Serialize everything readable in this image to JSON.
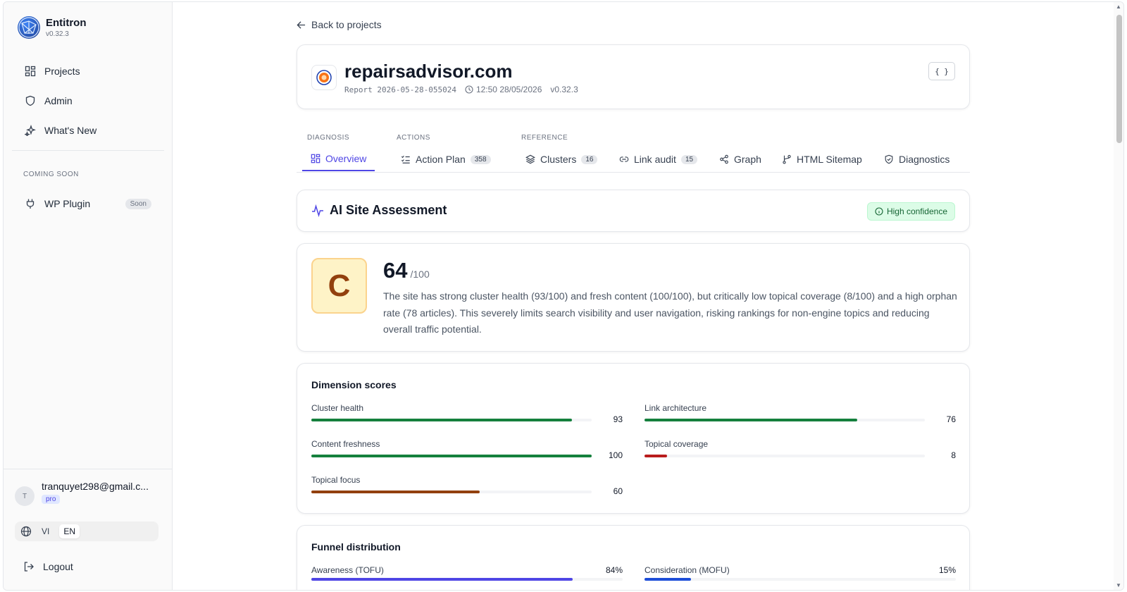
{
  "sidebar": {
    "brand": {
      "name": "Entitron",
      "version": "v0.32.3"
    },
    "nav": [
      {
        "label": "Projects",
        "icon": "grid-icon"
      },
      {
        "label": "Admin",
        "icon": "shield-icon"
      },
      {
        "label": "What's New",
        "icon": "sparkles-icon"
      }
    ],
    "coming_soon_label": "COMING SOON",
    "wp_plugin": {
      "label": "WP Plugin",
      "badge": "Soon"
    },
    "user": {
      "initial": "T",
      "email": "tranquyet298@gmail.c...",
      "plan": "pro"
    },
    "languages": [
      "VI",
      "EN"
    ],
    "active_language": "EN",
    "logout_label": "Logout"
  },
  "main": {
    "back_label": "Back to projects",
    "header": {
      "title": "repairsadvisor.com",
      "report": "Report 2026-05-28-055024",
      "time": "12:50 28/05/2026",
      "version": "v0.32.3",
      "json_button": "{ }"
    },
    "tab_groups": [
      "DIAGNOSIS",
      "ACTIONS",
      "REFERENCE"
    ],
    "tabs": [
      {
        "label": "Overview",
        "count": ""
      },
      {
        "label": "Action Plan",
        "count": "358"
      },
      {
        "label": "Clusters",
        "count": "16"
      },
      {
        "label": "Link audit",
        "count": "15"
      },
      {
        "label": "Graph",
        "count": ""
      },
      {
        "label": "HTML Sitemap",
        "count": ""
      },
      {
        "label": "Diagnostics",
        "count": ""
      }
    ],
    "assessment": {
      "title": "AI Site Assessment",
      "confidence": "High confidence"
    },
    "score": {
      "grade": "C",
      "value": "64",
      "max": "/100",
      "summary": "The site has strong cluster health (93/100) and fresh content (100/100), but critically low topical coverage (8/100) and a high orphan rate (78 articles). This severely limits search visibility and user navigation, risking rankings for non-engine topics and reducing overall traffic potential."
    },
    "dimensions": {
      "title": "Dimension scores",
      "items": [
        {
          "label": "Cluster health",
          "value": 93,
          "color": "#15803d"
        },
        {
          "label": "Link architecture",
          "value": 76,
          "color": "#15803d"
        },
        {
          "label": "Content freshness",
          "value": 100,
          "color": "#15803d"
        },
        {
          "label": "Topical coverage",
          "value": 8,
          "color": "#b91c1c"
        },
        {
          "label": "Topical focus",
          "value": 60,
          "color": "#92400e"
        }
      ]
    },
    "funnel": {
      "title": "Funnel distribution",
      "items": [
        {
          "label": "Awareness (TOFU)",
          "pct": "84%",
          "value": 84,
          "color": "#4f46e5"
        },
        {
          "label": "Consideration (MOFU)",
          "pct": "15%",
          "value": 15,
          "color": "#1d4ed8"
        }
      ]
    }
  }
}
